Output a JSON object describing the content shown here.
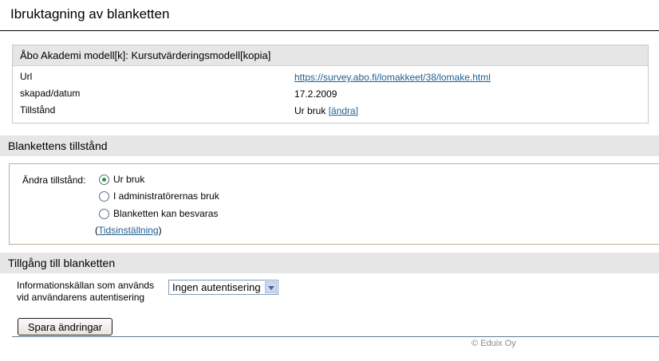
{
  "page": {
    "title": "Ibruktagning av blanketten"
  },
  "form_info": {
    "name": "Åbo Akademi modell[k]: Kursutvärderingsmodell[kopia]",
    "url_label": "Url",
    "url_value": "https://survey.abo.fi/lomakkeet/38/lomake.html",
    "created_label": "skapad/datum",
    "created_value": "17.2.2009",
    "state_label": "Tillstånd",
    "state_value": "Ur bruk",
    "state_change_link": "[ändra]"
  },
  "state_section": {
    "title": "Blankettens tillstånd",
    "change_label": "Ändra tillstånd:",
    "options": [
      {
        "label": "Ur bruk",
        "checked": true
      },
      {
        "label": "I administratörernas bruk",
        "checked": false
      },
      {
        "label": "Blanketten kan besvaras",
        "checked": false
      }
    ],
    "scheduling_open": "(",
    "scheduling_link": "Tidsinställning",
    "scheduling_close": ")"
  },
  "access_section": {
    "title": "Tillgång till blanketten",
    "auth_label_line1": "Informationskällan som används",
    "auth_label_line2": "vid användarens autentisering",
    "auth_selected": "Ingen autentisering"
  },
  "save_button": "Spara ändringar",
  "footer": "© Eduix Oy",
  "colors": {
    "link": "#1f5f8f",
    "section_bg": "#e6e6e6",
    "radio_dot": "#2a9a3c"
  }
}
